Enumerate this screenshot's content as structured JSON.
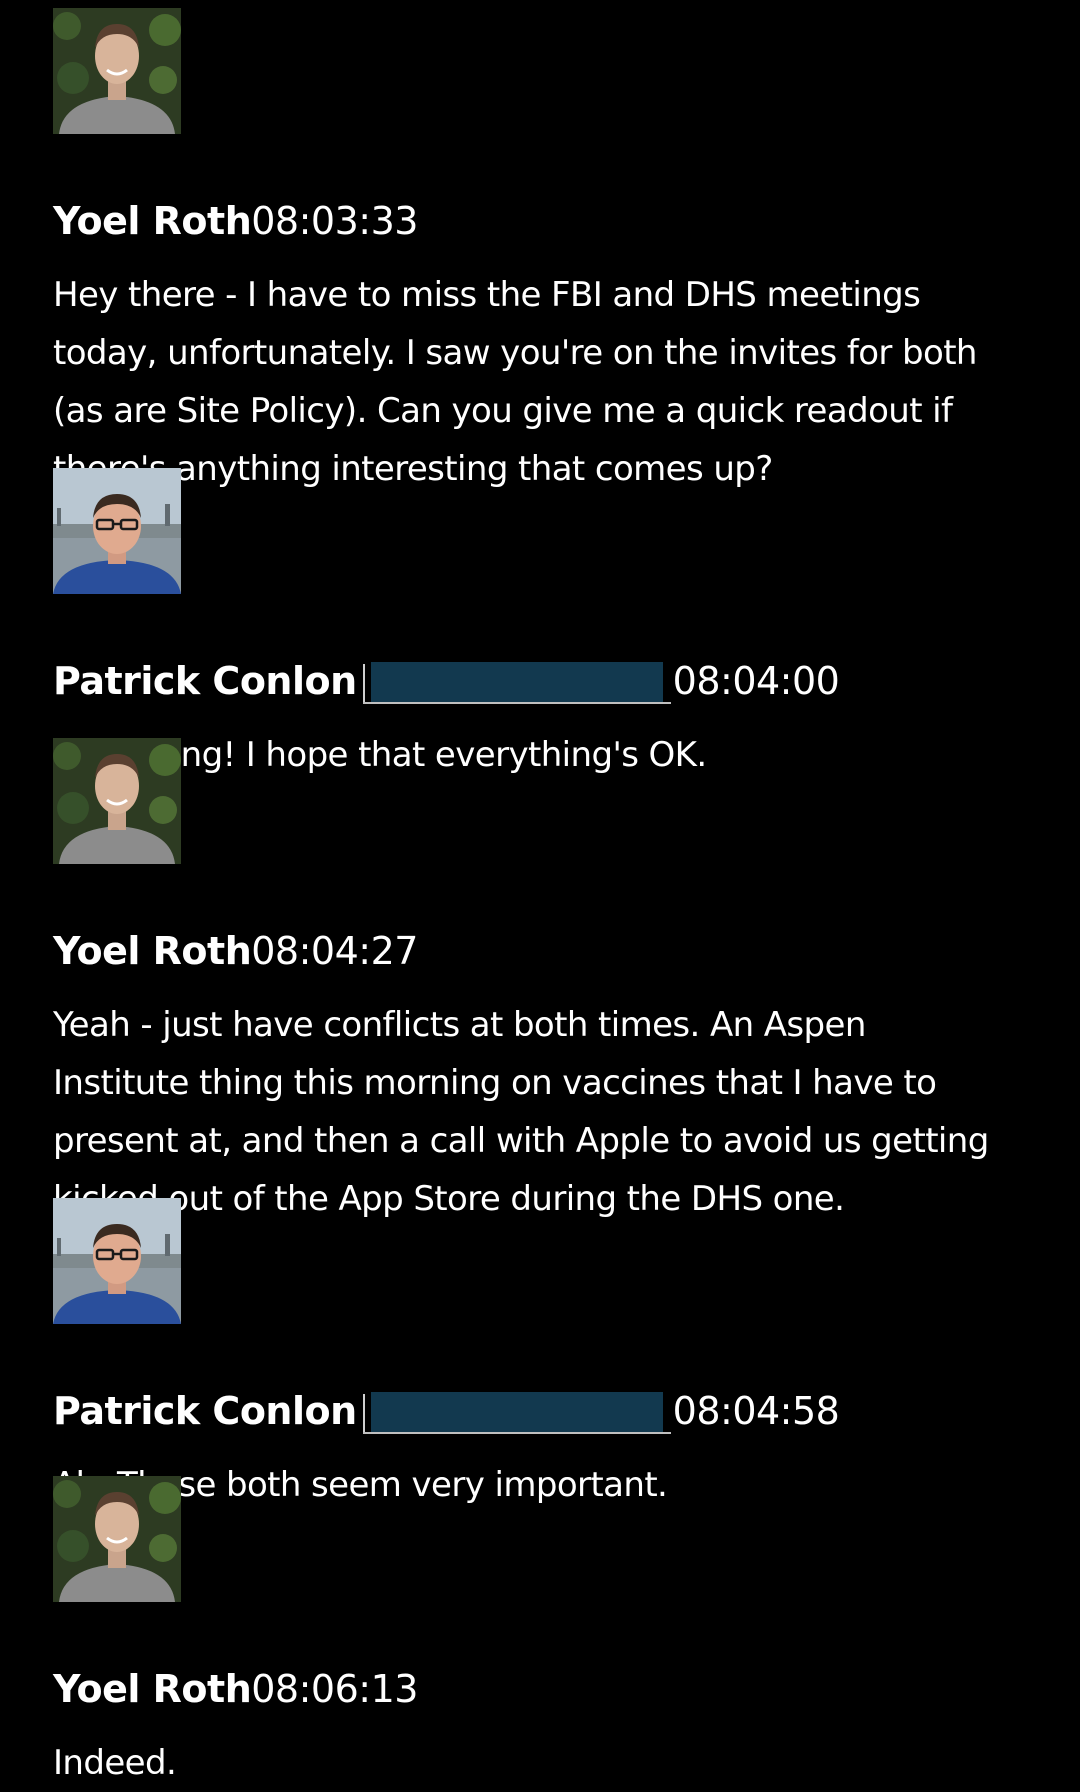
{
  "messages": [
    {
      "sender": "Yoel Roth",
      "time": "08:03:33",
      "text": "Hey there - I have to miss the FBI and DHS meetings\ntoday, unfortunately. I saw you're on the invites for both\n(as are Site Policy). Can you give me a quick readout if\nthere's anything interesting that comes up?"
    },
    {
      "sender": "Patrick Conlon",
      "time": "08:04:00",
      "text": "Sure thing! I hope that everything's OK."
    },
    {
      "sender": "Yoel Roth",
      "time": "08:04:27",
      "text": "Yeah - just have conflicts at both times. An Aspen\nInstitute thing this morning on vaccines that I have to\npresent at, and then a call with Apple to avoid us getting\nkicked out of the App Store during the DHS one."
    },
    {
      "sender": "Patrick Conlon",
      "time": "08:04:58",
      "text": "Ah. Those both seem very important."
    },
    {
      "sender": "Yoel Roth",
      "time": "08:06:13",
      "text": "Indeed."
    }
  ],
  "colors": {
    "background": "#000000",
    "text": "#ffffff",
    "redaction": "#12394f"
  }
}
